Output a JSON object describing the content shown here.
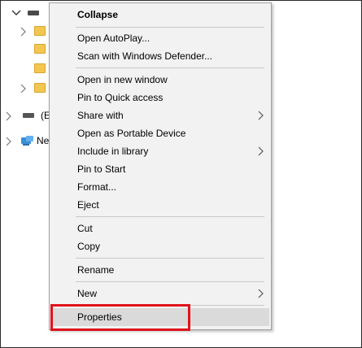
{
  "tree": {
    "partial_labels": {
      "drive_e": "(E",
      "network": "Ne"
    }
  },
  "menu": {
    "items": [
      {
        "label": "Collapse"
      },
      {
        "label": "Open AutoPlay..."
      },
      {
        "label": "Scan with Windows Defender..."
      },
      {
        "label": "Open in new window"
      },
      {
        "label": "Pin to Quick access"
      },
      {
        "label": "Share with"
      },
      {
        "label": "Open as Portable Device"
      },
      {
        "label": "Include in library"
      },
      {
        "label": "Pin to Start"
      },
      {
        "label": "Format..."
      },
      {
        "label": "Eject"
      },
      {
        "label": "Cut"
      },
      {
        "label": "Copy"
      },
      {
        "label": "Rename"
      },
      {
        "label": "New"
      },
      {
        "label": "Properties"
      }
    ]
  },
  "colors": {
    "highlight_border": "#e0131b",
    "menu_background": "#f2f2f2",
    "hover_background": "#dadada"
  }
}
